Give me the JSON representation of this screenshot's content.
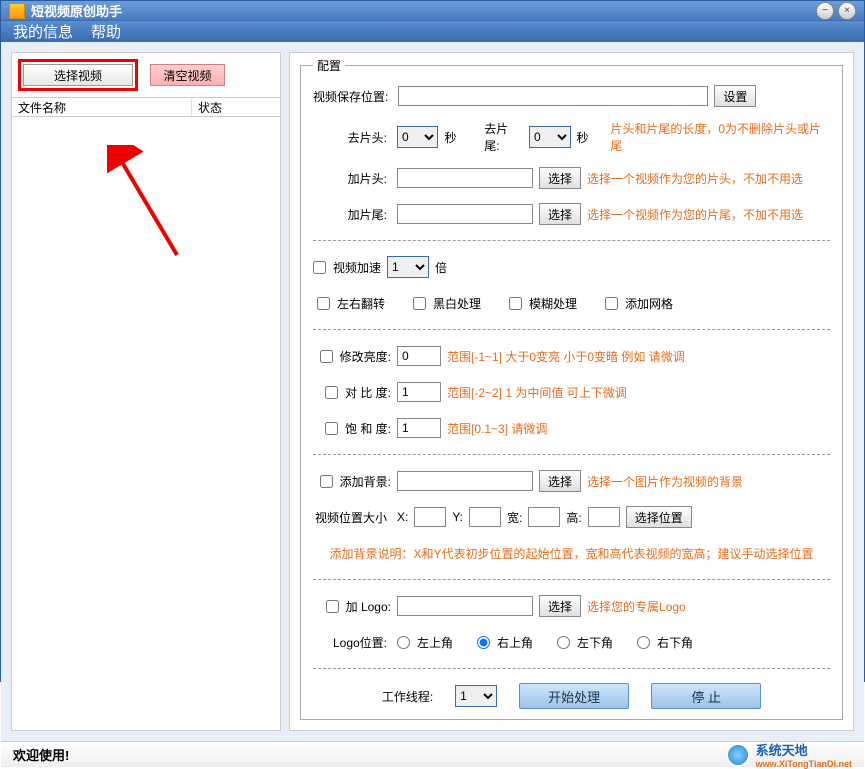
{
  "window": {
    "title": "短视频原创助手"
  },
  "menu": {
    "info": "我的信息",
    "help": "帮助"
  },
  "left": {
    "select_video": "选择视频",
    "clear_video": "清空视频",
    "col_name": "文件名称",
    "col_status": "状态"
  },
  "config": {
    "legend": "配置",
    "save_location_label": "视频保存位置:",
    "save_location": "",
    "set_btn": "设置",
    "trim_head_label": "去片头:",
    "trim_head": "0",
    "seconds": "秒",
    "trim_tail_label": "去片尾:",
    "trim_tail": "0",
    "trim_hint": "片头和片尾的长度，0为不删除片头或片尾",
    "add_head_label": "加片头:",
    "add_head": "",
    "choose_btn": "选择",
    "add_head_hint": "选择一个视频作为您的片头，不加不用选",
    "add_tail_label": "加片尾:",
    "add_tail": "",
    "add_tail_hint": "选择一个视频作为您的片尾，不加不用选",
    "speedup_label": "视频加速",
    "speedup_value": "1",
    "times": "倍",
    "flip_label": "左右翻转",
    "bw_label": "黑白处理",
    "blur_label": "模糊处理",
    "grid_label": "添加网格",
    "brightness_label": "修改亮度:",
    "brightness_value": "0",
    "brightness_hint": "范围[-1~1]   大于0变亮 小于0变暗  例如 请微调",
    "contrast_label": "对 比  度:",
    "contrast_value": "1",
    "contrast_hint": "范围[-2~2]  1 为中间值  可上下微调",
    "saturation_label": "饱 和  度:",
    "saturation_value": "1",
    "saturation_hint": "范围[0.1~3]   请微调",
    "bg_label": "添加背景:",
    "bg_value": "",
    "bg_hint": "选择一个图片作为视频的背景",
    "pos_label": "视频位置大小",
    "x_label": "X:",
    "x_value": "",
    "y_label": "Y:",
    "y_value": "",
    "w_label": "宽:",
    "w_value": "",
    "h_label": "高:",
    "h_value": "",
    "pos_btn": "选择位置",
    "pos_hint": "添加背景说明：X和Y代表初步位置的起始位置，宽和高代表视频的宽高；建议手动选择位置",
    "logo_label": "加 Logo:",
    "logo_value": "",
    "logo_hint": "选择您的专属Logo",
    "logo_pos_label": "Logo位置:",
    "logo_tl": "左上角",
    "logo_tr": "右上角",
    "logo_bl": "左下角",
    "logo_br": "右下角",
    "threads_label": "工作线程:",
    "threads_value": "1",
    "start_btn": "开始处理",
    "stop_btn": "停    止"
  },
  "status": {
    "welcome": "欢迎使用!"
  },
  "watermark": {
    "cn": "系统天地",
    "en": "www.XiTongTianDi.net"
  }
}
